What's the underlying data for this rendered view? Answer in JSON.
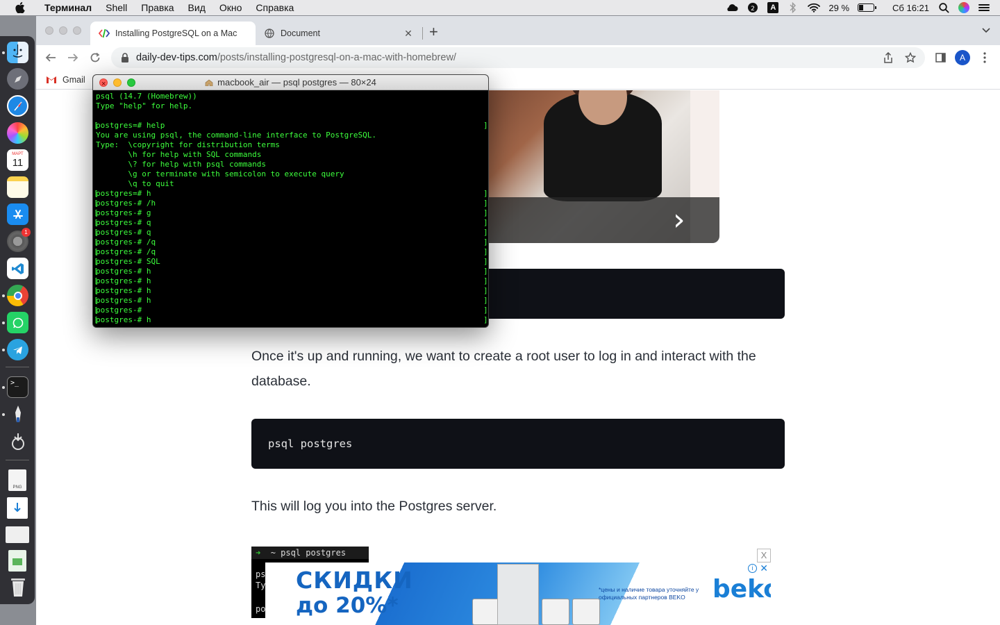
{
  "menubar": {
    "app_name": "Терминал",
    "items": [
      "Shell",
      "Правка",
      "Вид",
      "Окно",
      "Справка"
    ],
    "battery_percent": "29 %",
    "battery_level": 0.29,
    "clock": "Сб 16:21",
    "keyboard_layout": "A"
  },
  "dock": {
    "apps": [
      "finder-icon",
      "launchpad-icon",
      "safari-icon",
      "photos-icon",
      "calendar-icon",
      "notes-icon",
      "app-store-icon",
      "system-preferences-icon",
      "vscode-icon",
      "chrome-icon",
      "whatsapp-icon",
      "telegram-icon",
      "terminal-icon",
      "pen-tool-icon",
      "screenshot-icon",
      "png-file-icon",
      "installer-file-icon",
      "chrome-file-icon",
      "numbers-file-icon",
      "trash-icon"
    ],
    "calendar_month": "МАРТ",
    "calendar_day": "11",
    "sysprefs_badge": "1"
  },
  "chrome": {
    "tabs": [
      {
        "title": "Installing PostgreSQL on a Mac",
        "active": true
      },
      {
        "title": "Document",
        "active": false
      }
    ],
    "url_host": "daily-dev-tips.com",
    "url_path": "/posts/installing-postgresql-on-a-mac-with-homebrew/",
    "profile_initial": "A",
    "bookmark": "Gmail"
  },
  "page": {
    "para1": "Once it's up and running, we want to create a root user to log in and interact with the database.",
    "code2": "psql postgres",
    "para2": "This will log you into the Postgres server.",
    "mini_terminal": {
      "prompt": "~ psql postgres",
      "line1": "ps",
      "line2": "Ty",
      "line3": "po"
    },
    "ad": {
      "line1": "СКИДКИ",
      "line2": "до 20%*",
      "note": "*цены и наличие товара уточняйте у официальных партнеров BEKO",
      "brand": "beko",
      "close_label": "X",
      "info_label": "i"
    }
  },
  "terminal": {
    "title": "macbook_air — psql postgres — 80×24",
    "lines": [
      "psql (14.7 (Homebrew))",
      "Type \"help\" for help.",
      "",
      "postgres=# help",
      "You are using psql, the command-line interface to PostgreSQL.",
      "Type:  \\copyright for distribution terms",
      "       \\h for help with SQL commands",
      "       \\? for help with psql commands",
      "       \\g or terminate with semicolon to execute query",
      "       \\q to quit",
      "postgres=# h",
      "postgres-# /h",
      "postgres-# g",
      "postgres-# q",
      "postgres-# q",
      "postgres-# /q",
      "postgres-# /q",
      "postgres-# SQL",
      "postgres-# h",
      "postgres-# h",
      "postgres-# h",
      "postgres-# h",
      "postgres-#",
      "postgres-# h"
    ],
    "marked_lines": [
      3,
      10,
      11,
      12,
      13,
      14,
      15,
      16,
      17,
      18,
      19,
      20,
      21,
      22,
      23
    ]
  },
  "colors": {
    "terminal_text": "#3dff3d",
    "terminal_bg": "#000000",
    "code_bg": "#0f1117",
    "ad_blue": "#1565c0"
  }
}
